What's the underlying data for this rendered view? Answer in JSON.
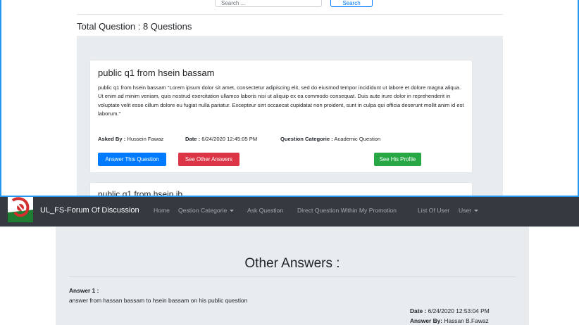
{
  "search": {
    "placeholder": "Search ...",
    "button_label": "Search"
  },
  "total_questions": "Total Question : 8 Questions",
  "question": {
    "title": "public q1 from hsein bassam",
    "body": "public q1 from hsein bassam \"Lorem ipsum dolor sit amet, consectetur adipiscing elit, sed do eiusmod tempor incididunt ut labore et dolore magna aliqua. Ut enim ad minim veniam, quis nostrud exercitation ullamco laboris nisi ut aliquip ex ea commodo consequat. Duis aute irure dolor in reprehenderit in voluptate velit esse cillum dolore eu fugiat nulla pariatur. Excepteur sint occaecat cupidatat non proident, sunt in culpa qui officia deserunt mollit anim id est laborum.\"",
    "asked_by_label": "Asked By :",
    "asked_by": "Hussein Fawaz",
    "date_label": "Date :",
    "date": "6/24/2020 12:45:05 PM",
    "category_label": "Question Categorie :",
    "category": "Academic Question",
    "answer_button": "Answer This Question",
    "other_answers_button": "See Other Answers",
    "profile_button": "See His Profile"
  },
  "question_next_title": "public q1 from hsein ib",
  "navbar": {
    "brand": "UL_FS-Forum Of Discussion",
    "items": [
      "Home",
      "Qestion Categorie",
      "Ask Question",
      "Direct Question Within My Promotion",
      "List Of User",
      "User"
    ]
  },
  "answers": {
    "heading": "Other Answers :",
    "items": [
      {
        "label": "Answer 1 :",
        "text": "answer from hassan bassam to hsein bassam on his public question",
        "date_label": "Date :",
        "date": "6/24/2020 12:53:04 PM",
        "by_label": "Answer By:",
        "by": "Hassan B.Fawaz"
      }
    ]
  },
  "colors": {
    "accent": "#2196f3",
    "navbar": "#343a40",
    "primary": "#007bff",
    "danger": "#dc3545",
    "success": "#28a745",
    "panel": "#e9ecef"
  }
}
